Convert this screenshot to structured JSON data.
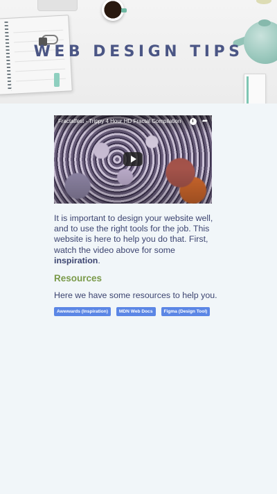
{
  "hero": {
    "title": "WEB DESIGN TIPS"
  },
  "video": {
    "title": "Fractalfest - Trippy 4 Hour HD Fractal Compilation",
    "share_icon": "share-icon",
    "clock_icon": "clock-icon",
    "play_icon": "play-icon"
  },
  "intro": {
    "text_before": "It is important to design your website well, and to use the right tools for the job. This website is here to help you do that. First, watch the video above for some ",
    "emphasis": "inspiration",
    "text_after": "."
  },
  "resources": {
    "heading": "Resources",
    "text": "Here we have some resources to help you.",
    "links": [
      {
        "label": "Awwwards (Inspiration)"
      },
      {
        "label": "MDN Web Docs"
      },
      {
        "label": "Figma (Design Tool)"
      }
    ]
  },
  "colors": {
    "background": "#f1f6f9",
    "title": "#4b5685",
    "text": "#3c4470",
    "heading_accent": "#7a9a4a",
    "button": "#5b86e5"
  }
}
